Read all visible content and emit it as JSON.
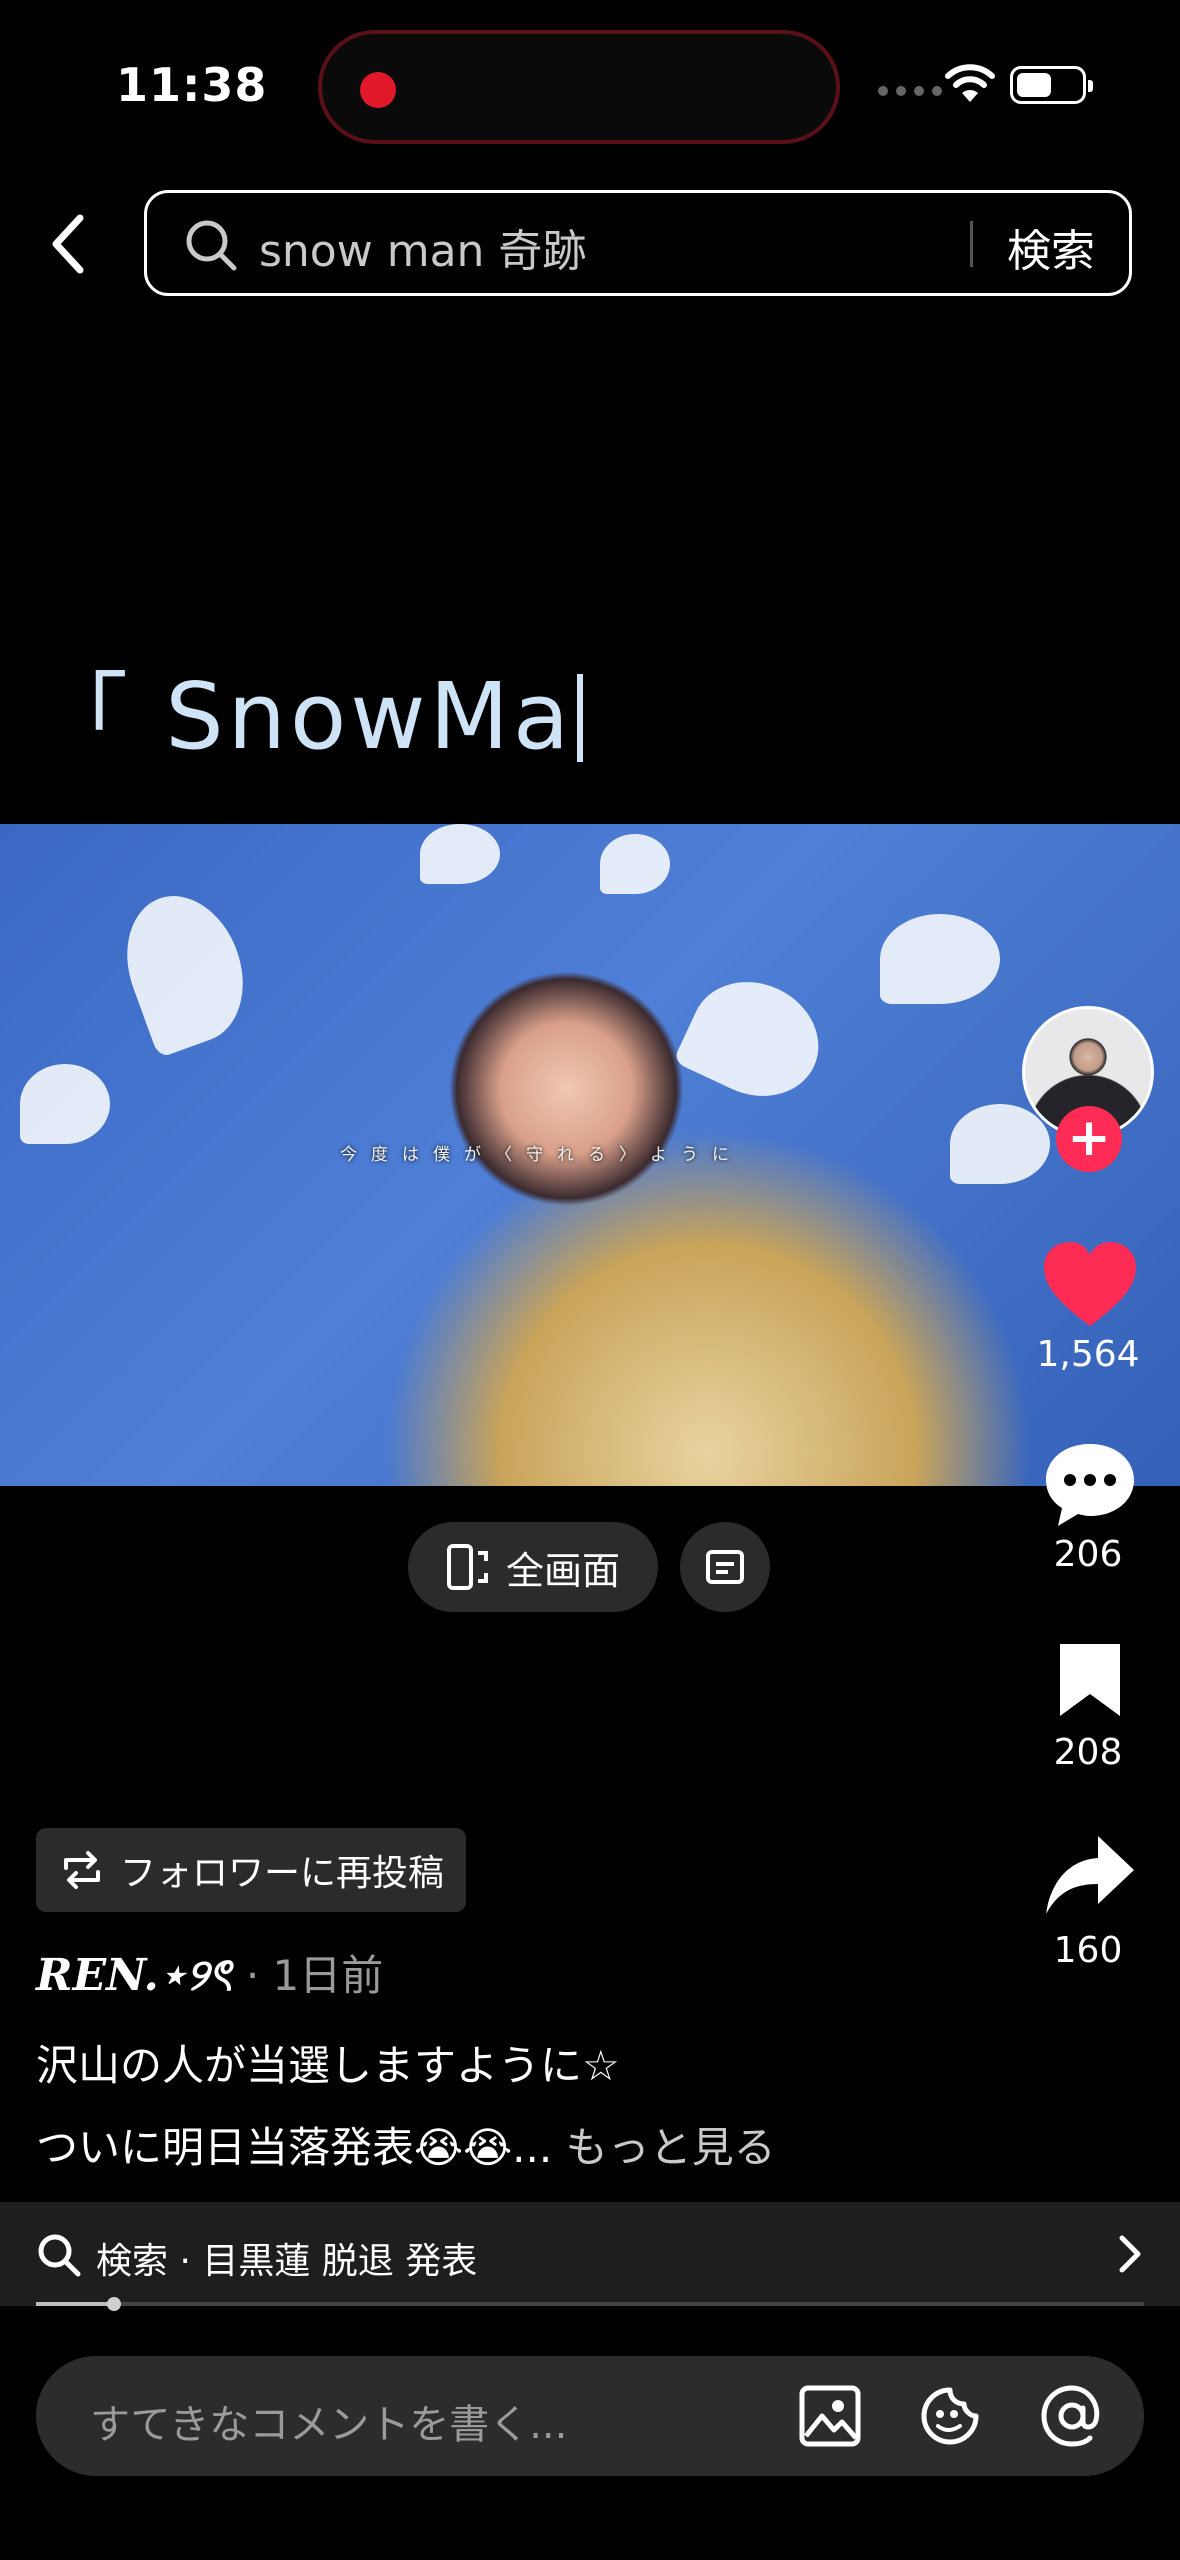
{
  "status_bar": {
    "time": "11:38"
  },
  "search": {
    "query": "snow man 奇跡",
    "submit_label": "検索"
  },
  "video": {
    "title_text": "「 SnowMa",
    "subtitle": "今度は僕が〈守れる〉ように"
  },
  "rail": {
    "likes": "1,564",
    "comments": "206",
    "bookmarks": "208",
    "shares": "160"
  },
  "controls": {
    "fullscreen_label": "全画面"
  },
  "post": {
    "repost_label": "フォロワーに再投稿",
    "author": "REN.⋆୨ৎ",
    "time": "· 1日前",
    "caption_line_1": "沢山の人が当選しますように☆",
    "caption_line_2": "ついに明日当落発表😭😭...",
    "see_more": "もっと見る"
  },
  "related_search": {
    "label": "検索 · 目黒蓮 脱退 発表"
  },
  "progress": {
    "played_fraction": 0.07
  },
  "comment_bar": {
    "placeholder": "すてきなコメントを書く..."
  },
  "colors": {
    "accent": "#fe2c55",
    "background": "#000000",
    "title_text": "#cfe3f7"
  },
  "icons": [
    "back-icon",
    "search-icon",
    "wifi-icon",
    "battery-icon",
    "heart-icon",
    "comment-icon",
    "bookmark-icon",
    "share-icon",
    "fullscreen-icon",
    "pip-icon",
    "repost-icon",
    "chevron-right-icon",
    "image-icon",
    "emoji-icon",
    "mention-icon"
  ]
}
